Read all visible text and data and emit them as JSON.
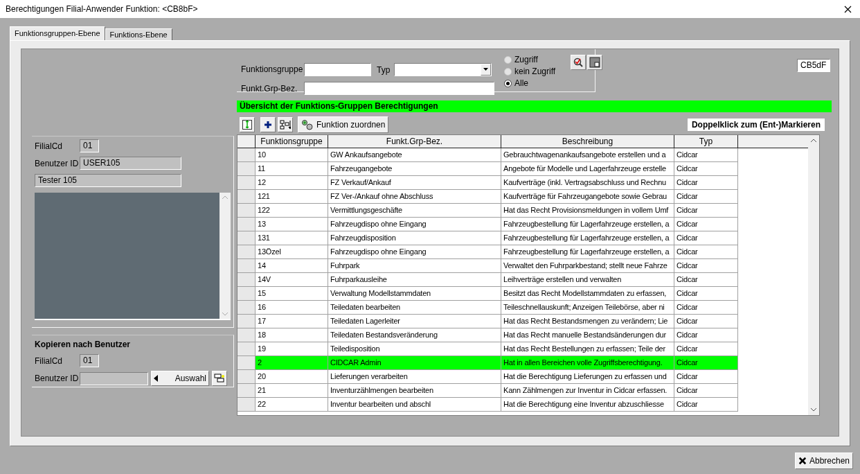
{
  "window": {
    "title": "Berechtigungen Filial-Anwender Funktion: <CB8bF>"
  },
  "tabs": [
    {
      "label": "Funktionsgruppen-Ebene",
      "selected": true
    },
    {
      "label": "Funktions-Ebene",
      "selected": false
    }
  ],
  "user": {
    "filial_label": "FilialCd",
    "filial_value": "01",
    "user_label": "Benutzer ID",
    "user_value": "USER105",
    "name_value": "Tester 105"
  },
  "copy": {
    "title": "Kopieren nach Benutzer",
    "filial_label": "FilialCd",
    "filial_value": "01",
    "user_label": "Benutzer ID",
    "select_button": "Auswahl"
  },
  "filter": {
    "group_label": "Funktionsgruppe",
    "type_label": "Typ",
    "name_label": "Funkt.Grp-Bez.",
    "radios": [
      {
        "label": "Zugriff",
        "selected": false
      },
      {
        "label": "kein Zugriff",
        "selected": false
      },
      {
        "label": "Alle",
        "selected": true
      }
    ]
  },
  "code_field": "CB5dF",
  "overview": {
    "title": "Übersicht der Funktions-Gruppen Berechtigungen",
    "assign_button": "Funktion zuordnen",
    "hint": "Doppelklick zum (Ent-)Markieren"
  },
  "table": {
    "columns": [
      "Funktionsgruppe",
      "Funkt.Grp-Bez.",
      "Beschreibung",
      "Typ"
    ],
    "rows": [
      {
        "cells": [
          "10",
          "GW Ankaufsangebote",
          "Gebrauchtwagenankaufsangebote erstellen und a",
          "Cidcar"
        ],
        "selected": false
      },
      {
        "cells": [
          "11",
          "Fahrzeugangebote",
          "Angebote für Modelle und Lagerfahrzeuge erstelle",
          "Cidcar"
        ],
        "selected": false
      },
      {
        "cells": [
          "12",
          "FZ Verkauf/Ankauf",
          "Kaufverträge (inkl. Vertragsabschluss und Rechnu",
          "Cidcar"
        ],
        "selected": false
      },
      {
        "cells": [
          "121",
          "FZ Ver-/Ankauf ohne Abschluss",
          "Kaufverträge für Fahrzeugangebote sowie Gebrau",
          "Cidcar"
        ],
        "selected": false
      },
      {
        "cells": [
          "122",
          "Vermittlungsgeschäfte",
          "Hat das Recht Provisionsmeldungen in vollem Umf",
          "Cidcar"
        ],
        "selected": false
      },
      {
        "cells": [
          "13",
          "Fahrzeugdispo ohne Eingang",
          "Fahrzeugbestellung für Lagerfahrzeuge erstellen, a",
          "Cidcar"
        ],
        "selected": false
      },
      {
        "cells": [
          "131",
          "Fahrzeugdisposition",
          "Fahrzeugbestellung für Lagerfahrzeuge erstellen, a",
          "Cidcar"
        ],
        "selected": false
      },
      {
        "cells": [
          "13Özel",
          "Fahrzeugdispo ohne Eingang",
          "Fahrzeugbestellung für Lagerfahrzeuge erstellen, a",
          "Cidcar"
        ],
        "selected": false
      },
      {
        "cells": [
          "14",
          "Fuhrpark",
          "Verwaltet den Fuhrparkbestand; stellt neue Fahrze",
          "Cidcar"
        ],
        "selected": false
      },
      {
        "cells": [
          "14V",
          "Fuhrparkausleihe",
          "Leihverträge erstellen und verwalten",
          "Cidcar"
        ],
        "selected": false
      },
      {
        "cells": [
          "15",
          "Verwaltung Modellstammdaten",
          "Besitzt das Recht Modellstammdaten zu erfassen,",
          "Cidcar"
        ],
        "selected": false
      },
      {
        "cells": [
          "16",
          "Teiledaten bearbeiten",
          "Teileschnellauskunft; Anzeigen Teilebörse, aber ni",
          "Cidcar"
        ],
        "selected": false
      },
      {
        "cells": [
          "17",
          "Teiledaten Lagerleiter",
          "Hat das Recht Bestandsmengen zu verändern; Lie",
          "Cidcar"
        ],
        "selected": false
      },
      {
        "cells": [
          "18",
          "Teiledaten Bestandsveränderung",
          "Hat das Recht manuelle Bestandsänderungen dur",
          "Cidcar"
        ],
        "selected": false
      },
      {
        "cells": [
          "19",
          "Teiledisposition",
          "Hat das Recht Bestellungen zu erfassen; Teile der",
          "Cidcar"
        ],
        "selected": false
      },
      {
        "cells": [
          "2",
          "CIDCAR Admin",
          "Hat in allen Bereichen volle Zugriffsberechtigung.",
          "Cidcar"
        ],
        "selected": true
      },
      {
        "cells": [
          "20",
          "Lieferungen verarbeiten",
          "Hat die Berechtigung Lieferungen zu erfassen und",
          "Cidcar"
        ],
        "selected": false
      },
      {
        "cells": [
          "21",
          "Inventurzählmengen bearbeiten",
          "Kann Zählmengen zur Inventur in Cidcar erfassen.",
          "Cidcar"
        ],
        "selected": false
      },
      {
        "cells": [
          "22",
          "Inventur bearbeiten und abschl",
          "Hat die Berechtigung eine Inventur abzuschliesse",
          "Cidcar"
        ],
        "selected": false
      }
    ]
  },
  "cancel_button": "Abbrechen"
}
